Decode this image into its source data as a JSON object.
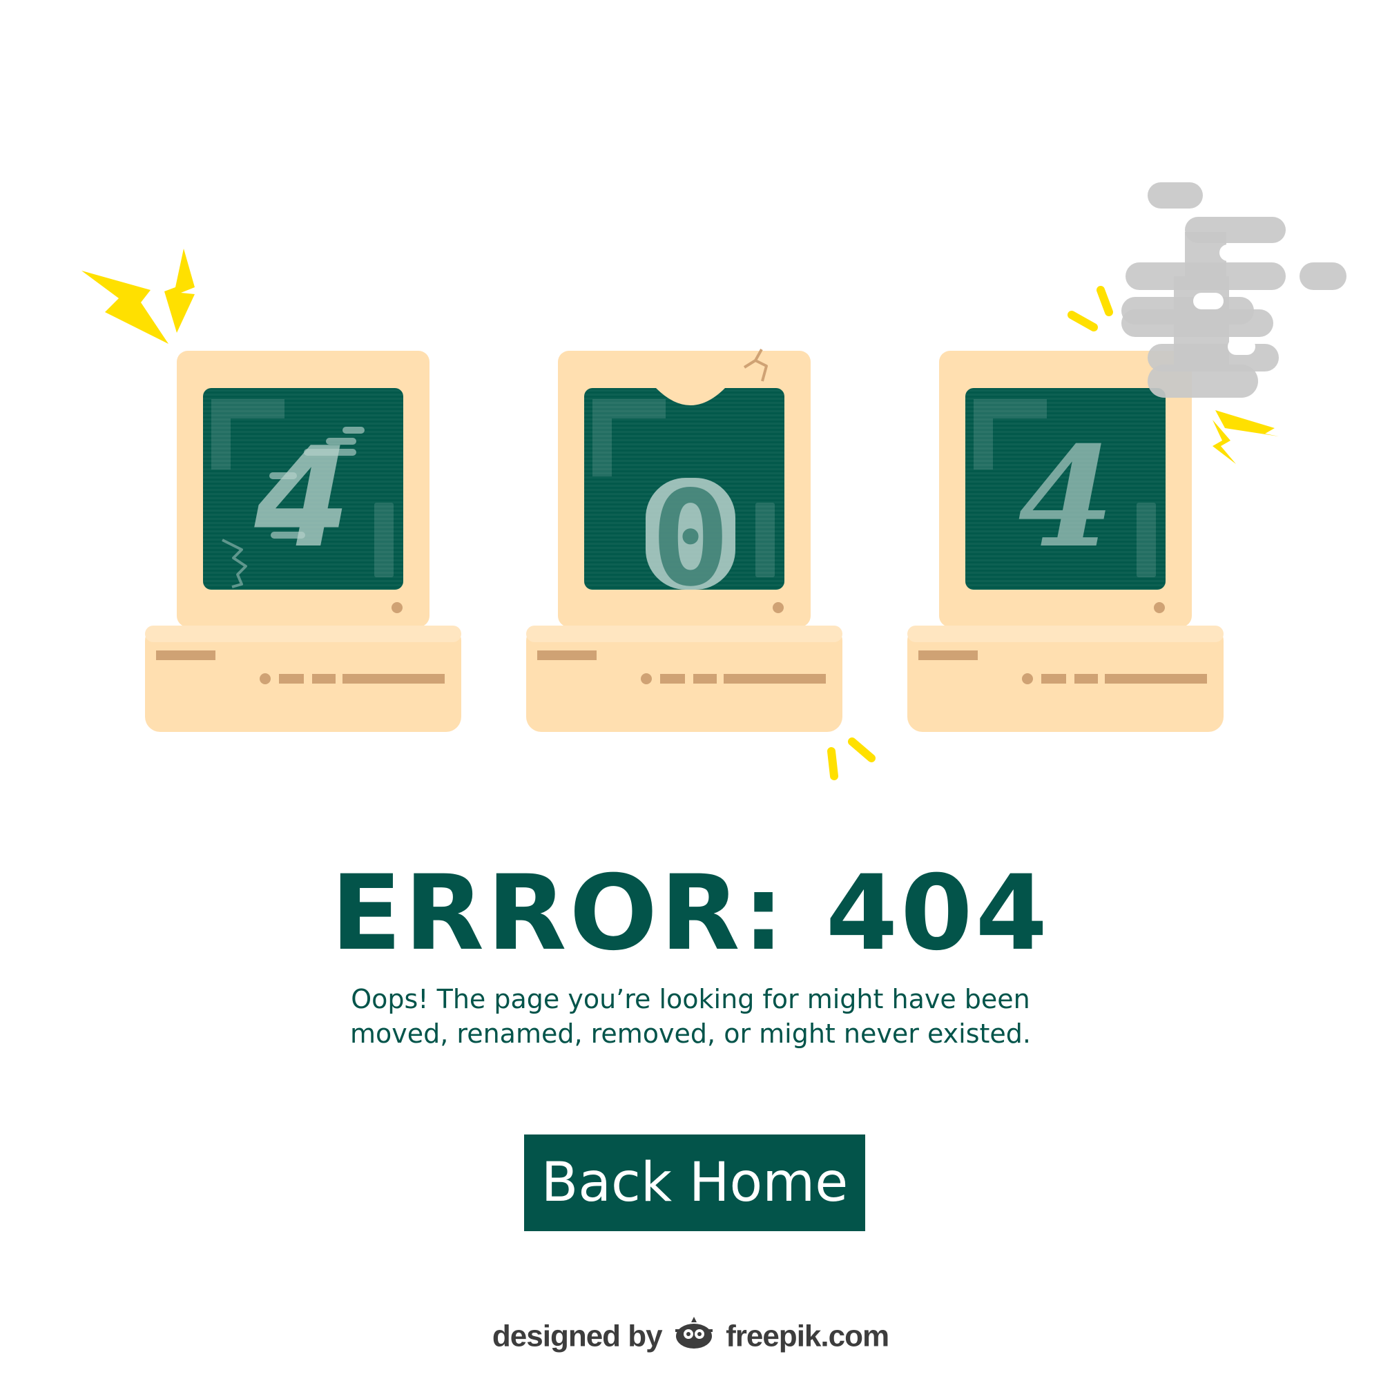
{
  "screens": {
    "left_digit": "4",
    "middle_digit": "0",
    "right_digit": "4"
  },
  "error": {
    "title": "ERROR: 404",
    "message_line1": "Oops! The page you’re looking for might have been",
    "message_line2": "moved, renamed, removed, or might never existed."
  },
  "actions": {
    "back_home_label": "Back Home"
  },
  "credit": {
    "prefix": "designed by",
    "brand": "freepik.com"
  },
  "icons": {
    "lightning": "lightning-bolt-icon",
    "smoke": "smoke-cloud-icon",
    "spark": "spark-lines-icon",
    "crack": "crack-icon",
    "logo": "freepik-logo-icon"
  },
  "colors": {
    "brand_green": "#03544a",
    "screen_green": "#03594b",
    "case_beige": "#ffdfb0",
    "case_detail": "#cfa274",
    "lightning_yellow": "#ffe000",
    "smoke_gray": "#c8c8c8"
  }
}
